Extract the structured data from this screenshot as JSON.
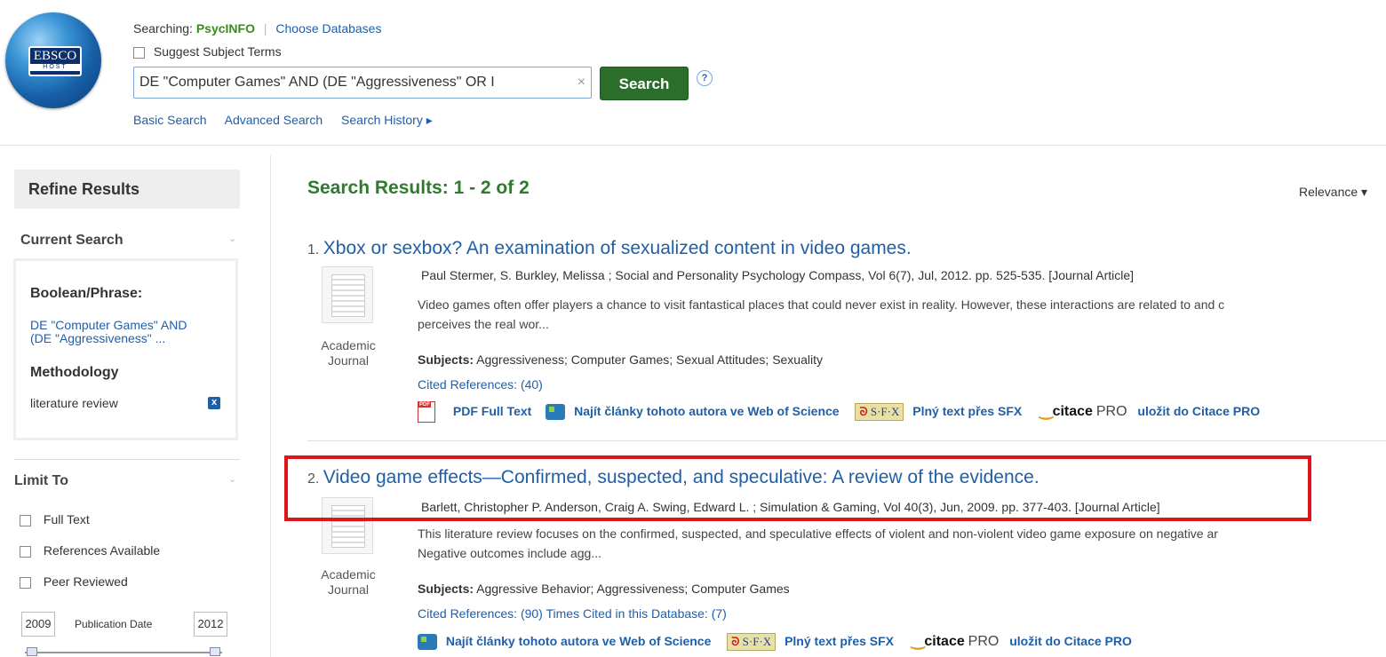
{
  "header": {
    "logo_text": "EBSCO",
    "logo_sub": "HOST",
    "searching_label": "Searching:",
    "database": "PsycINFO",
    "choose_databases": "Choose Databases",
    "suggest_subject_terms": "Suggest Subject Terms",
    "search_query": "DE \"Computer Games\" AND (DE \"Aggressiveness\" OR I",
    "search_button": "Search",
    "help": "?",
    "nav": [
      "Basic Search",
      "Advanced Search",
      "Search History ▸"
    ]
  },
  "sidebar": {
    "refine_title": "Refine Results",
    "current_search_title": "Current Search",
    "boolean_label": "Boolean/Phrase:",
    "boolean_value_line1": "DE \"Computer Games\" AND",
    "boolean_value_line2": "(DE \"Aggressiveness\" ...",
    "methodology_label": "Methodology",
    "methodology_value": "literature review",
    "remove_icon": "x",
    "limit_to_title": "Limit To",
    "limits": [
      "Full Text",
      "References Available",
      "Peer Reviewed"
    ],
    "date_from": "2009",
    "date_label": "Publication Date",
    "date_to": "2012"
  },
  "results": {
    "title": "Search Results: 1 - 2 of 2",
    "sort": "Relevance ▾",
    "items": [
      {
        "num": "1.",
        "title": "Xbox or sexbox? An examination of sexualized content in video games.",
        "meta": "Paul Stermer, S. Burkley, Melissa ; Social and Personality Psychology Compass, Vol 6(7), Jul, 2012. pp. 525-535. [Journal Article]",
        "abstract1": "Video games often offer players a chance to visit fantastical places that could never exist in reality. However, these interactions are related to and c",
        "abstract2": "perceives the real wor...",
        "type_line1": "Academic",
        "type_line2": "Journal",
        "subjects_label": "Subjects:",
        "subjects": "Aggressiveness; Computer Games; Sexual Attitudes; Sexuality",
        "cited": "Cited References: (40)",
        "pdf": "PDF Full Text",
        "wos": "Najít články tohoto autora ve Web of Science",
        "sfx_text": "Plný text přes SFX",
        "citace_save": "uložit do Citace PRO"
      },
      {
        "num": "2.",
        "title": "Video game effects—Confirmed, suspected, and speculative: A review of the evidence.",
        "meta": "Barlett, Christopher P. Anderson, Craig A. Swing, Edward L. ; Simulation & Gaming, Vol 40(3), Jun, 2009. pp. 377-403. [Journal Article]",
        "abstract1": "This literature review focuses on the confirmed, suspected, and speculative effects of violent and non-violent video game exposure on negative ar",
        "abstract2": "Negative outcomes include agg...",
        "type_line1": "Academic",
        "type_line2": "Journal",
        "subjects_label": "Subjects:",
        "subjects": "Aggressive Behavior; Aggressiveness; Computer Games",
        "cited": "Cited References: (90) Times Cited in this Database: (7)",
        "wos": "Najít články tohoto autora ve Web of Science",
        "sfx_text": "Plný text přes SFX",
        "citace_save": "uložit do Citace PRO"
      }
    ],
    "sfx_logo": "S·F·X",
    "citace_logo": "citace",
    "citace_pro": "PRO"
  },
  "colors": {
    "link": "#1f5fa8",
    "green": "#2e7a2e",
    "search_button": "#2b6e2b",
    "highlight_box": "#e0151a"
  }
}
